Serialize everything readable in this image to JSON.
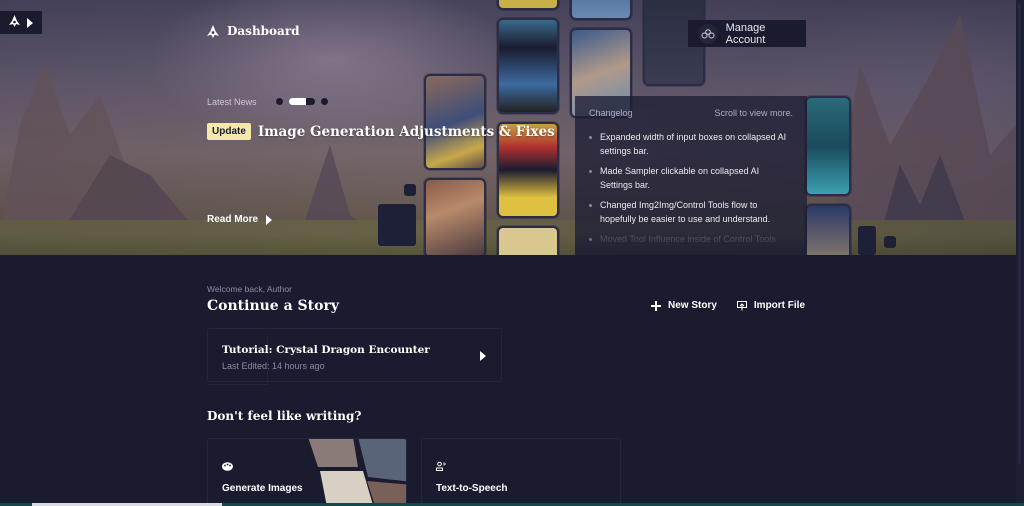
{
  "header": {
    "title": "Dashboard",
    "manage_account_label": "Manage Account"
  },
  "news": {
    "label": "Latest News",
    "carousel": {
      "count": 4,
      "active_index": 1
    },
    "badge": "Update",
    "headline": "Image Generation Adjustments & Fixes",
    "read_more_label": "Read More"
  },
  "changelog": {
    "title": "Changelog",
    "hint": "Scroll to view more.",
    "items": [
      "Expanded width of input boxes on collapsed AI settings bar.",
      "Made Sampler clickable on collapsed AI Settings bar.",
      "Changed Img2Img/Control Tools flow to hopefully be easier to use and understand.",
      "Moved Tool Influence inside of Control Tools"
    ]
  },
  "main": {
    "welcome": "Welcome back, Author",
    "section_title": "Continue a Story",
    "new_story_label": "New Story",
    "import_file_label": "Import File",
    "story": {
      "title": "Tutorial: Crystal Dragon Encounter",
      "last_edited": "Last Edited: 14 hours ago"
    },
    "alt_title": "Don't feel like writing?",
    "tools": [
      {
        "label": "Generate Images",
        "icon": "palette-icon"
      },
      {
        "label": "Text-to-Speech",
        "icon": "speaker-person-icon"
      }
    ]
  },
  "colors": {
    "background": "#1a1b2e",
    "badge": "#f5e8a8",
    "text_muted": "#8f8da3"
  }
}
